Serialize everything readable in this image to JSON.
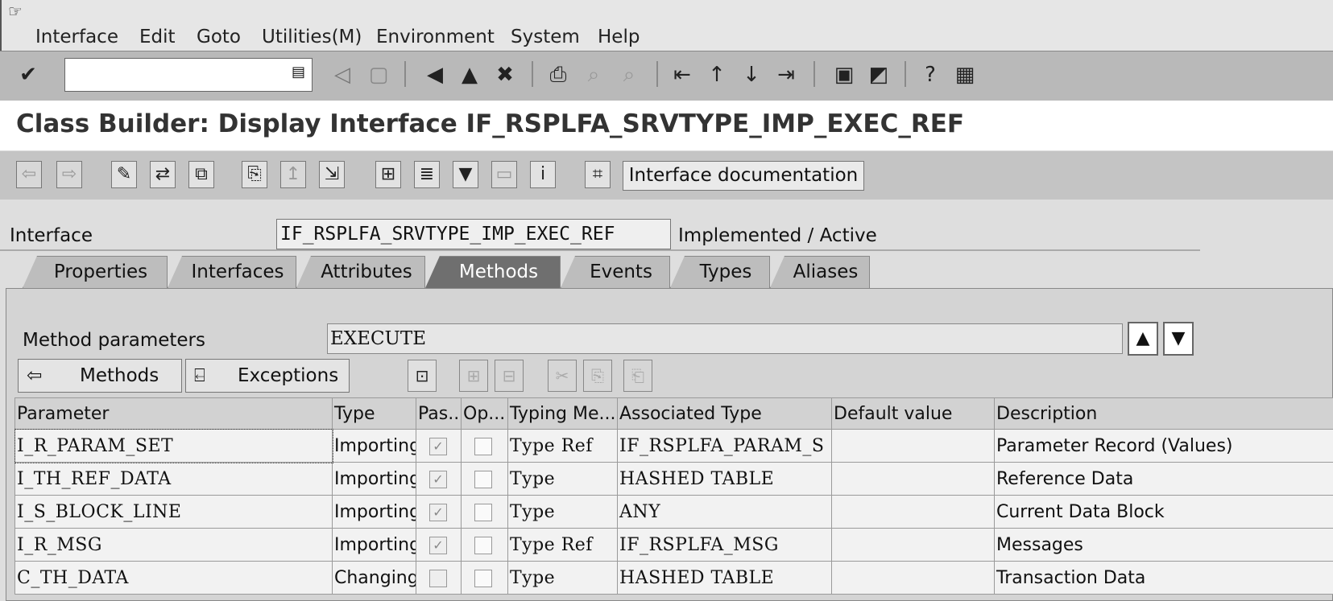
{
  "menu": [
    "Interface",
    "Edit",
    "Goto",
    "Utilities(M)",
    "Environment",
    "System",
    "Help"
  ],
  "title": "Class Builder: Display Interface IF_RSPLFA_SRVTYPE_IMP_EXEC_REF",
  "toolbar2": {
    "doc_button": "Interface documentation"
  },
  "header": {
    "interface_label": "Interface",
    "interface_value": "IF_RSPLFA_SRVTYPE_IMP_EXEC_REF",
    "status": "Implemented / Active"
  },
  "tabs": [
    "Properties",
    "Interfaces",
    "Attributes",
    "Methods",
    "Events",
    "Types",
    "Aliases"
  ],
  "active_tab": "Methods",
  "method_params": {
    "label": "Method parameters",
    "value": "EXECUTE"
  },
  "nav": {
    "methods": "Methods",
    "exceptions": "Exceptions"
  },
  "columns": [
    "Parameter",
    "Type",
    "Pas...",
    "Op...",
    "Typing Me...",
    "Associated Type",
    "Default value",
    "Description"
  ],
  "rows": [
    {
      "parameter": "I_R_PARAM_SET",
      "type": "Importing",
      "pass": true,
      "optional": false,
      "typing": "Type Ref",
      "assoc": "IF_RSPLFA_PARAM_S",
      "default": "",
      "description": "Parameter Record (Values)"
    },
    {
      "parameter": "I_TH_REF_DATA",
      "type": "Importing",
      "pass": true,
      "optional": false,
      "typing": "Type",
      "assoc": "HASHED TABLE",
      "default": "",
      "description": "Reference Data"
    },
    {
      "parameter": "I_S_BLOCK_LINE",
      "type": "Importing",
      "pass": true,
      "optional": false,
      "typing": "Type",
      "assoc": "ANY",
      "default": "",
      "description": "Current Data Block"
    },
    {
      "parameter": "I_R_MSG",
      "type": "Importing",
      "pass": true,
      "optional": false,
      "typing": "Type Ref",
      "assoc": "IF_RSPLFA_MSG",
      "default": "",
      "description": "Messages"
    },
    {
      "parameter": "C_TH_DATA",
      "type": "Changing",
      "pass": false,
      "optional": false,
      "typing": "Type",
      "assoc": "HASHED TABLE",
      "default": "",
      "description": "Transaction Data"
    }
  ]
}
